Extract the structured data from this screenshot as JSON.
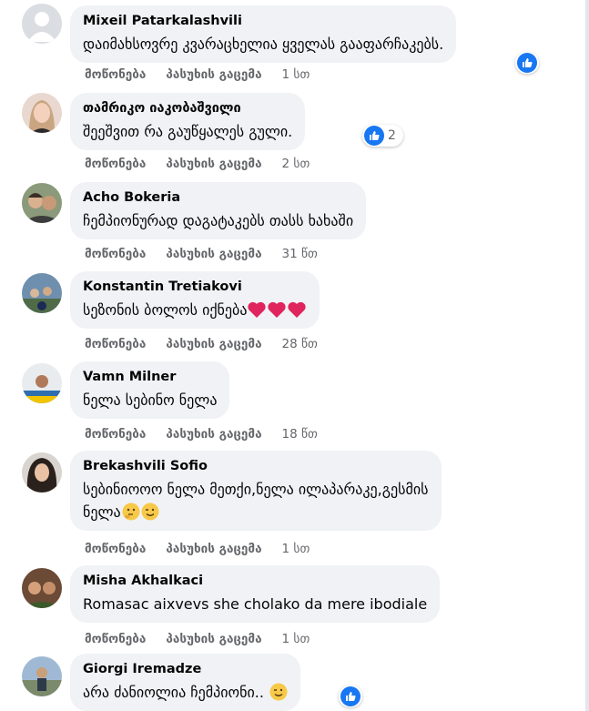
{
  "actions": {
    "like": "მოწონება",
    "reply": "პასუხის გაცემა"
  },
  "colors": {
    "bubble": "#f0f2f5",
    "meta": "#65676b",
    "like_blue": "#1877f2"
  },
  "comments": [
    {
      "author": "Mixeil Patarkalashvili",
      "text": "დაიმახსოვრე კვარაცხელია ყველას გააფარჩაკებს.",
      "time": "1 სთ",
      "reaction": "like",
      "reaction_count": ""
    },
    {
      "author": "თამრიკო იაკობაშვილი",
      "text": "შეეშვით რა გაუწყალეს გული.",
      "time": "2 სთ",
      "reaction": "like",
      "reaction_count": "2"
    },
    {
      "author": "Acho Bokeria",
      "text": "ჩემპიონურად დაგატაკებს თასს ხახაში",
      "time": "31 წთ"
    },
    {
      "author": "Konstantin Tretiakovi",
      "text": "სეზონის ბოლოს იქნება",
      "emojis": [
        "heart-icon",
        "heart-icon",
        "heart-icon"
      ],
      "time": "28 წთ"
    },
    {
      "author": "Vamn Milner",
      "text": "ნელა სებინო ნელა",
      "time": "18 წთ"
    },
    {
      "author": "Brekashvili Sofio",
      "text": "სებინიოოო ნელა მეთქი,ნელა ილაპარაკე,გესმის",
      "text2": "ნელა",
      "emojis": [
        "thinking-face-icon",
        "winking-face-icon"
      ],
      "time": "1 სთ"
    },
    {
      "author": "Misha Akhalkaci",
      "text": "Romasac aixvevs she cholako da mere ibodiale",
      "time": "1 სთ"
    },
    {
      "author": "Giorgi Iremadze",
      "text": "არა ძანიოლია ჩემპიონი..",
      "emojis": [
        "winking-face-icon"
      ],
      "reaction": "like",
      "reaction_count": ""
    }
  ]
}
